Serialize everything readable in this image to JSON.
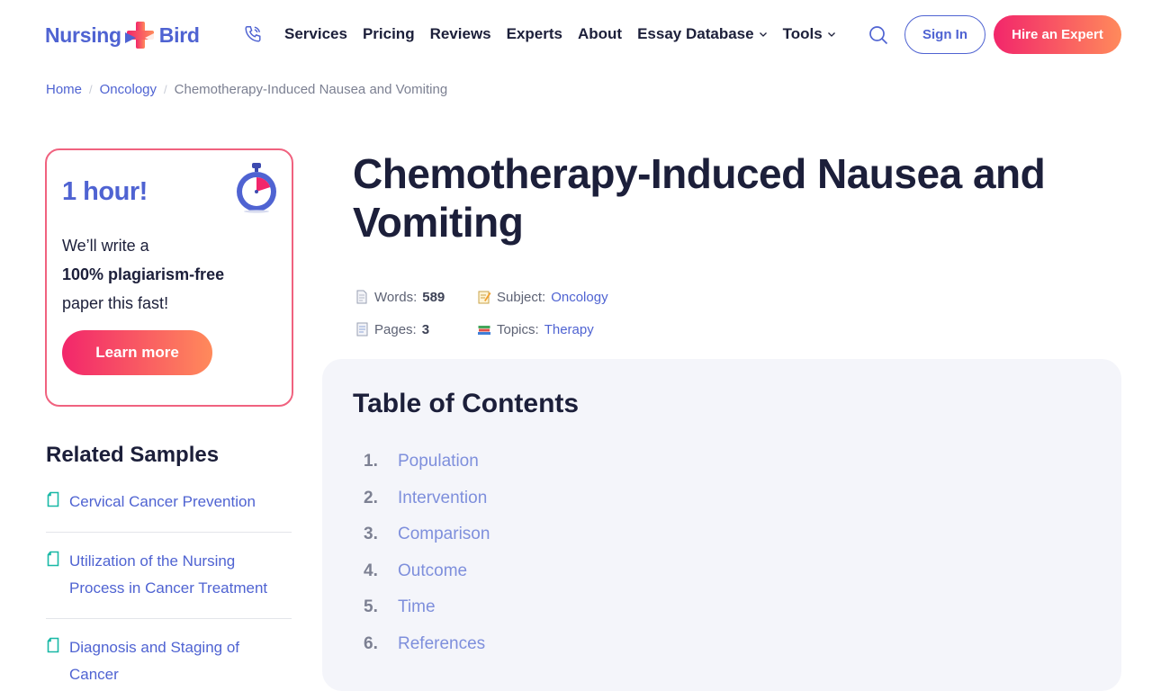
{
  "brand": {
    "name_left": "Nursing",
    "name_right": "Bird",
    "primary": "#4f63d2",
    "accent": "#f2266b"
  },
  "nav": {
    "items": [
      {
        "label": "Services",
        "dropdown": false
      },
      {
        "label": "Pricing",
        "dropdown": false
      },
      {
        "label": "Reviews",
        "dropdown": false
      },
      {
        "label": "Experts",
        "dropdown": false
      },
      {
        "label": "About",
        "dropdown": false
      },
      {
        "label": "Essay Database",
        "dropdown": true
      },
      {
        "label": "Tools",
        "dropdown": true
      }
    ],
    "signin_label": "Sign In",
    "hire_label": "Hire an Expert"
  },
  "breadcrumb": {
    "home": "Home",
    "category": "Oncology",
    "current": "Chemotherapy-Induced Nausea and Vomiting",
    "separator": "/"
  },
  "promo": {
    "title": "1 hour!",
    "line1": "We’ll write a",
    "line2": "100% plagiarism-free",
    "line3": "paper this fast!",
    "button": "Learn more"
  },
  "related": {
    "title": "Related Samples",
    "items": [
      "Cervical Cancer Prevention",
      "Utilization of the Nursing Process in Cancer Treatment",
      "Diagnosis and Staging of Cancer"
    ]
  },
  "article": {
    "title": "Chemotherapy-Induced Nausea and Vomiting",
    "meta": {
      "words_label": "Words:",
      "words_value": "589",
      "subject_label": "Subject:",
      "subject_value": "Oncology",
      "pages_label": "Pages:",
      "pages_value": "3",
      "topics_label": "Topics:",
      "topics_value": "Therapy"
    }
  },
  "toc": {
    "title": "Table of Contents",
    "items": [
      {
        "num": "1.",
        "label": "Population"
      },
      {
        "num": "2.",
        "label": "Intervention"
      },
      {
        "num": "3.",
        "label": "Comparison"
      },
      {
        "num": "4.",
        "label": "Outcome"
      },
      {
        "num": "5.",
        "label": "Time"
      },
      {
        "num": "6.",
        "label": "References"
      }
    ]
  }
}
